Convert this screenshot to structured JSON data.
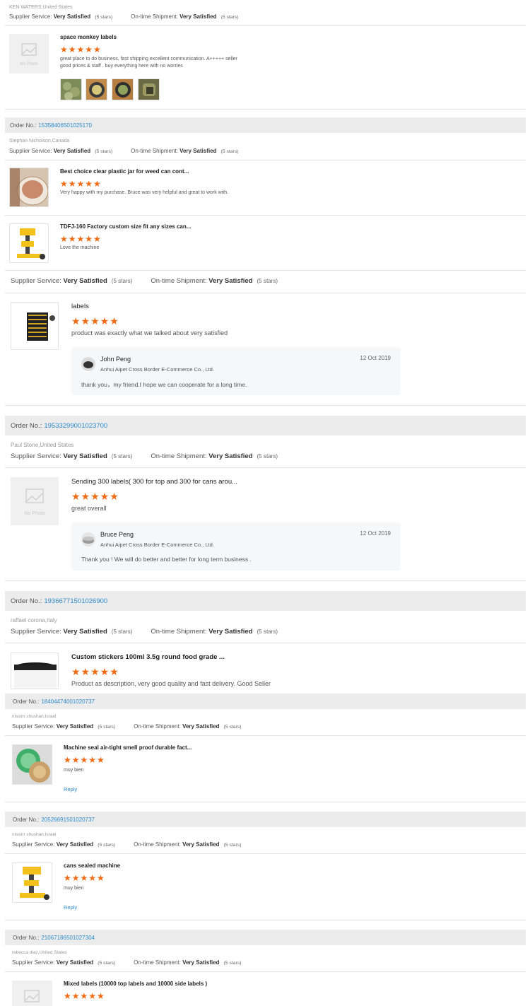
{
  "stars": "★★★★★",
  "labels": {
    "order": "Order No.:",
    "supplier": "Supplier Service:",
    "shipment": "On-time Shipment:",
    "nophoto": "No Photo",
    "reply": "Reply"
  },
  "colors": {
    "star": "#f06a14",
    "link": "#2d8ac9",
    "order_bar": "#ececec"
  },
  "orders": [
    {
      "buyer": "KEN WATERS,United States",
      "supplier": "Very Satisfied",
      "supplier_stars": "(5 stars)",
      "shipment": "Very Satisfied",
      "shipment_stars": "(5 stars)",
      "items": [
        {
          "title": "space monkey labels",
          "text1": "great place to do business, fast shipping excellent communication. A+++++ seller",
          "text2": "good prices & staff . buy everything here with no worries"
        }
      ]
    },
    {
      "order_no": "15358406501025170",
      "buyer": "Stephan Nicholson,Canada",
      "supplier": "Very Satisfied",
      "supplier_stars": "(5 stars)",
      "shipment": "Very Satisfied",
      "shipment_stars": "(5 stars)",
      "items": [
        {
          "title": "Best choice clear plastic jar for weed can cont...",
          "text": "Very happy with my purchase. Bruce was very helpful and great to work with."
        },
        {
          "title": "TDFJ-160 Factory custom size fit any sizes can...",
          "text": "Love the machine"
        }
      ]
    },
    {
      "supplier": "Very Satisfied",
      "supplier_stars": "(5 stars)",
      "shipment": "Very Satisfied",
      "shipment_stars": "(5 stars)",
      "items": [
        {
          "title": "labels",
          "text": "product was exactly what we talked about very satisfied"
        }
      ],
      "reply": {
        "name": "John Peng",
        "company": "Anhui Aipet Cross Border E-Commerce Co., Ltd.",
        "date": "12 Oct 2019",
        "text": "thank you，my friend.I hope we can cooperate for a long time."
      }
    },
    {
      "order_no": "19533299001023700",
      "buyer": "Paul Stone,United States",
      "supplier": "Very Satisfied",
      "supplier_stars": "(5 stars)",
      "shipment": "Very Satisfied",
      "shipment_stars": "(5 stars)",
      "items": [
        {
          "title": "Sending 300 labels( 300 for top and 300 for cans arou...",
          "text": "great overall"
        }
      ],
      "reply": {
        "name": "Bruce Peng",
        "company": "Anhui Aipet Cross Border E-Commerce Co., Ltd.",
        "date": "12 Oct 2019",
        "text": "Thank you ! We will do better and better for long term business ."
      }
    },
    {
      "order_no": "19366771501026900",
      "buyer": "raffael corona,Italy",
      "supplier": "Very Satisfied",
      "supplier_stars": "(5 stars)",
      "shipment": "Very Satisfied",
      "shipment_stars": "(5 stars)",
      "items": [
        {
          "title": "Custom stickers 100ml 3.5g round food grade ...",
          "text": "Product as description, very good quality and fast delivery. Good Seller"
        }
      ]
    },
    {
      "order_no": "18404474001020737",
      "buyer": "nissim shushan,Israel",
      "supplier": "Very Satisfied",
      "supplier_stars": "(5 stars)",
      "shipment": "Very Satisfied",
      "shipment_stars": "(5 stars)",
      "items": [
        {
          "title": "Machine seal air-tight smell proof durable fact...",
          "text": "muy bien"
        }
      ]
    },
    {
      "order_no": "20526691501020737",
      "buyer": "nissim shushan,Israel",
      "supplier": "Very Satisfied",
      "supplier_stars": "(5 stars)",
      "shipment": "Very Satisfied",
      "shipment_stars": "(5 stars)",
      "items": [
        {
          "title": "cans sealed machine",
          "text": "muy bien"
        }
      ]
    },
    {
      "order_no": "21067186501027304",
      "buyer": "rebecca diaz,United States",
      "supplier": "Very Satisfied",
      "supplier_stars": "(5 stars)",
      "shipment": "Very Satisfied",
      "shipment_stars": "(5 stars)",
      "items": [
        {
          "title": "Mixed labels (10000 top labels and 10000 side labels )"
        }
      ]
    }
  ]
}
